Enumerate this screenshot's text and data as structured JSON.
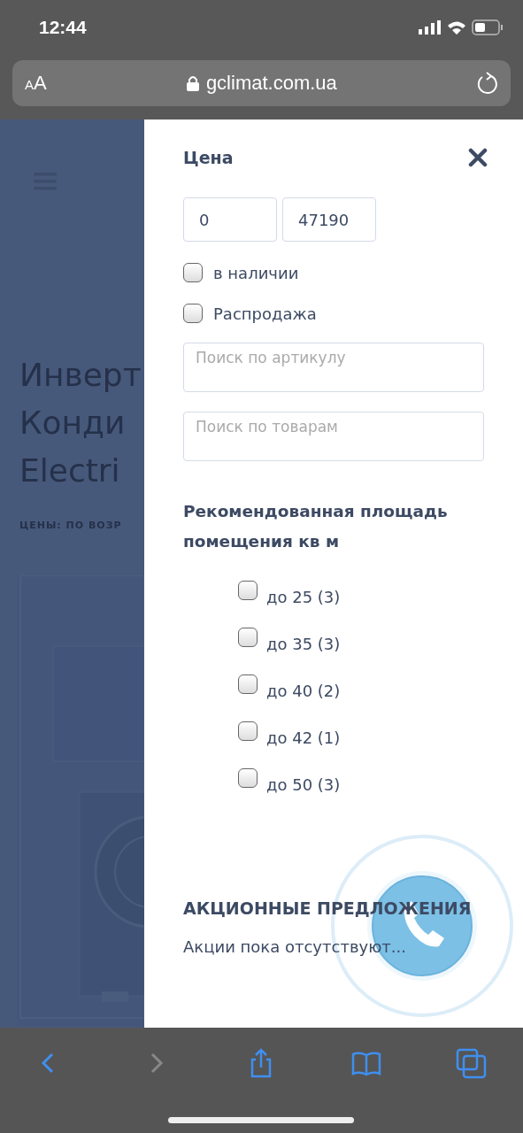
{
  "status_bar": {
    "time": "12:44"
  },
  "address_bar": {
    "text_size": "AA",
    "url": "gclimat.com.ua"
  },
  "background_page": {
    "title_lines": [
      "Инверт",
      "Конди",
      "Electri"
    ],
    "sort_label": "ЦЕНЫ: ПО ВОЗР"
  },
  "filter_panel": {
    "price": {
      "title": "Цена",
      "min": "0",
      "max": "47190"
    },
    "toggles": [
      {
        "label": "в наличии",
        "checked": false
      },
      {
        "label": "Распродажа",
        "checked": false
      }
    ],
    "search_fields": [
      {
        "placeholder": "Поиск по артикулу"
      },
      {
        "placeholder": "Поиск по товарам"
      }
    ],
    "area": {
      "title": "Рекомендованная площадь помещения кв м",
      "options": [
        {
          "label": "до 25 (3)",
          "checked": false
        },
        {
          "label": "до 35 (3)",
          "checked": false
        },
        {
          "label": "до 40 (2)",
          "checked": false
        },
        {
          "label": "до 42 (1)",
          "checked": false
        },
        {
          "label": "до 50 (3)",
          "checked": false
        }
      ]
    },
    "promotions": {
      "title": "АКЦИОННЫЕ ПРЕДЛОЖЕНИЯ",
      "text": "Акции пока отсутствуют..."
    }
  },
  "toolbar": [
    {
      "kind": "back",
      "disabled": false
    },
    {
      "kind": "forward",
      "disabled": true
    },
    {
      "kind": "share",
      "disabled": false
    },
    {
      "kind": "bookmarks",
      "disabled": false
    },
    {
      "kind": "tabs",
      "disabled": false
    }
  ]
}
